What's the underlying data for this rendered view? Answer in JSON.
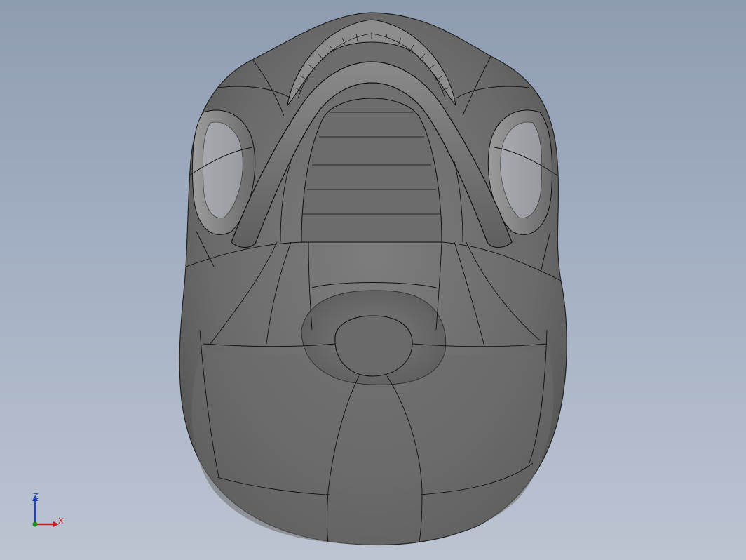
{
  "view": {
    "background_top": "#8e9cb2",
    "background_bottom": "#bcc4d2",
    "model_color": "#6e6e6e",
    "edge_color": "#111111"
  },
  "triad": {
    "z_label": "Z",
    "x_label": "X",
    "z_color": "#1f3fbf",
    "x_color": "#c02020",
    "origin_color": "#1a8a1a"
  }
}
